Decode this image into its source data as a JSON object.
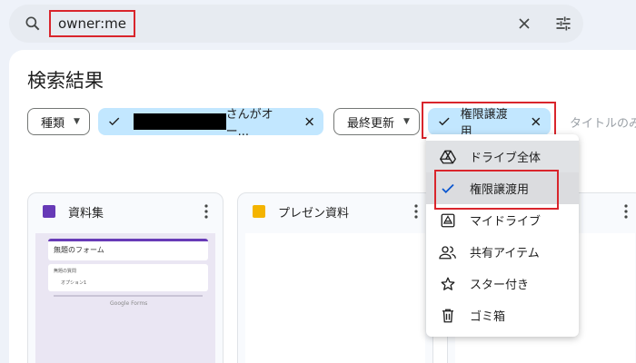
{
  "search": {
    "query": "owner:me"
  },
  "main": {
    "title": "検索結果",
    "chips": {
      "type_label": "種類",
      "owner_suffix": "さんがオー...",
      "modified_label": "最終更新",
      "transfer_label": "権限譲渡用",
      "title_placeholder": "タイトルのみ"
    },
    "files": [
      {
        "name": "資料集",
        "type": "form-icon",
        "color": "#673ab7",
        "thumb": {
          "form_title": "無題のフォーム",
          "q_label": "無題の質問",
          "q_option": "オプション1",
          "brand": "Google Forms"
        }
      },
      {
        "name": "プレゼン資料",
        "type": "slides-icon",
        "color": "#f4b400"
      }
    ]
  },
  "menu": {
    "items": [
      {
        "label": "ドライブ全体",
        "icon": "drive-icon"
      },
      {
        "label": "権限譲渡用",
        "icon": "check-icon"
      },
      {
        "label": "マイドライブ",
        "icon": "my-drive-icon"
      },
      {
        "label": "共有アイテム",
        "icon": "shared-people-icon"
      },
      {
        "label": "スター付き",
        "icon": "star-icon"
      },
      {
        "label": "ゴミ箱",
        "icon": "trash-icon"
      }
    ]
  },
  "colors": {
    "accent": "#0b57d0",
    "selected_chip": "#c2e7ff",
    "highlight": "#d9252c"
  }
}
